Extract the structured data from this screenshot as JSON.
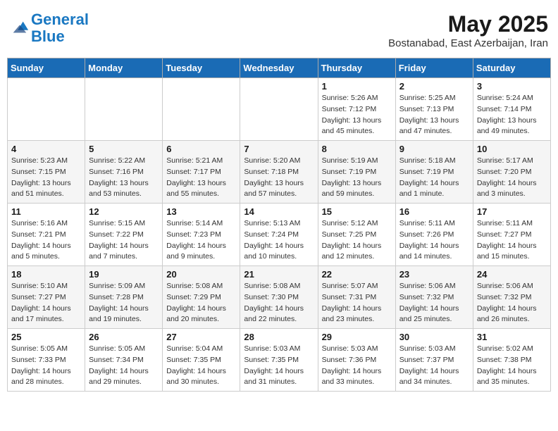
{
  "logo": {
    "line1": "General",
    "line2": "Blue"
  },
  "title": "May 2025",
  "location": "Bostanabad, East Azerbaijan, Iran",
  "days_of_week": [
    "Sunday",
    "Monday",
    "Tuesday",
    "Wednesday",
    "Thursday",
    "Friday",
    "Saturday"
  ],
  "weeks": [
    [
      {
        "day": "",
        "info": ""
      },
      {
        "day": "",
        "info": ""
      },
      {
        "day": "",
        "info": ""
      },
      {
        "day": "",
        "info": ""
      },
      {
        "day": "1",
        "info": "Sunrise: 5:26 AM\nSunset: 7:12 PM\nDaylight: 13 hours\nand 45 minutes."
      },
      {
        "day": "2",
        "info": "Sunrise: 5:25 AM\nSunset: 7:13 PM\nDaylight: 13 hours\nand 47 minutes."
      },
      {
        "day": "3",
        "info": "Sunrise: 5:24 AM\nSunset: 7:14 PM\nDaylight: 13 hours\nand 49 minutes."
      }
    ],
    [
      {
        "day": "4",
        "info": "Sunrise: 5:23 AM\nSunset: 7:15 PM\nDaylight: 13 hours\nand 51 minutes."
      },
      {
        "day": "5",
        "info": "Sunrise: 5:22 AM\nSunset: 7:16 PM\nDaylight: 13 hours\nand 53 minutes."
      },
      {
        "day": "6",
        "info": "Sunrise: 5:21 AM\nSunset: 7:17 PM\nDaylight: 13 hours\nand 55 minutes."
      },
      {
        "day": "7",
        "info": "Sunrise: 5:20 AM\nSunset: 7:18 PM\nDaylight: 13 hours\nand 57 minutes."
      },
      {
        "day": "8",
        "info": "Sunrise: 5:19 AM\nSunset: 7:19 PM\nDaylight: 13 hours\nand 59 minutes."
      },
      {
        "day": "9",
        "info": "Sunrise: 5:18 AM\nSunset: 7:19 PM\nDaylight: 14 hours\nand 1 minute."
      },
      {
        "day": "10",
        "info": "Sunrise: 5:17 AM\nSunset: 7:20 PM\nDaylight: 14 hours\nand 3 minutes."
      }
    ],
    [
      {
        "day": "11",
        "info": "Sunrise: 5:16 AM\nSunset: 7:21 PM\nDaylight: 14 hours\nand 5 minutes."
      },
      {
        "day": "12",
        "info": "Sunrise: 5:15 AM\nSunset: 7:22 PM\nDaylight: 14 hours\nand 7 minutes."
      },
      {
        "day": "13",
        "info": "Sunrise: 5:14 AM\nSunset: 7:23 PM\nDaylight: 14 hours\nand 9 minutes."
      },
      {
        "day": "14",
        "info": "Sunrise: 5:13 AM\nSunset: 7:24 PM\nDaylight: 14 hours\nand 10 minutes."
      },
      {
        "day": "15",
        "info": "Sunrise: 5:12 AM\nSunset: 7:25 PM\nDaylight: 14 hours\nand 12 minutes."
      },
      {
        "day": "16",
        "info": "Sunrise: 5:11 AM\nSunset: 7:26 PM\nDaylight: 14 hours\nand 14 minutes."
      },
      {
        "day": "17",
        "info": "Sunrise: 5:11 AM\nSunset: 7:27 PM\nDaylight: 14 hours\nand 15 minutes."
      }
    ],
    [
      {
        "day": "18",
        "info": "Sunrise: 5:10 AM\nSunset: 7:27 PM\nDaylight: 14 hours\nand 17 minutes."
      },
      {
        "day": "19",
        "info": "Sunrise: 5:09 AM\nSunset: 7:28 PM\nDaylight: 14 hours\nand 19 minutes."
      },
      {
        "day": "20",
        "info": "Sunrise: 5:08 AM\nSunset: 7:29 PM\nDaylight: 14 hours\nand 20 minutes."
      },
      {
        "day": "21",
        "info": "Sunrise: 5:08 AM\nSunset: 7:30 PM\nDaylight: 14 hours\nand 22 minutes."
      },
      {
        "day": "22",
        "info": "Sunrise: 5:07 AM\nSunset: 7:31 PM\nDaylight: 14 hours\nand 23 minutes."
      },
      {
        "day": "23",
        "info": "Sunrise: 5:06 AM\nSunset: 7:32 PM\nDaylight: 14 hours\nand 25 minutes."
      },
      {
        "day": "24",
        "info": "Sunrise: 5:06 AM\nSunset: 7:32 PM\nDaylight: 14 hours\nand 26 minutes."
      }
    ],
    [
      {
        "day": "25",
        "info": "Sunrise: 5:05 AM\nSunset: 7:33 PM\nDaylight: 14 hours\nand 28 minutes."
      },
      {
        "day": "26",
        "info": "Sunrise: 5:05 AM\nSunset: 7:34 PM\nDaylight: 14 hours\nand 29 minutes."
      },
      {
        "day": "27",
        "info": "Sunrise: 5:04 AM\nSunset: 7:35 PM\nDaylight: 14 hours\nand 30 minutes."
      },
      {
        "day": "28",
        "info": "Sunrise: 5:03 AM\nSunset: 7:35 PM\nDaylight: 14 hours\nand 31 minutes."
      },
      {
        "day": "29",
        "info": "Sunrise: 5:03 AM\nSunset: 7:36 PM\nDaylight: 14 hours\nand 33 minutes."
      },
      {
        "day": "30",
        "info": "Sunrise: 5:03 AM\nSunset: 7:37 PM\nDaylight: 14 hours\nand 34 minutes."
      },
      {
        "day": "31",
        "info": "Sunrise: 5:02 AM\nSunset: 7:38 PM\nDaylight: 14 hours\nand 35 minutes."
      }
    ]
  ]
}
